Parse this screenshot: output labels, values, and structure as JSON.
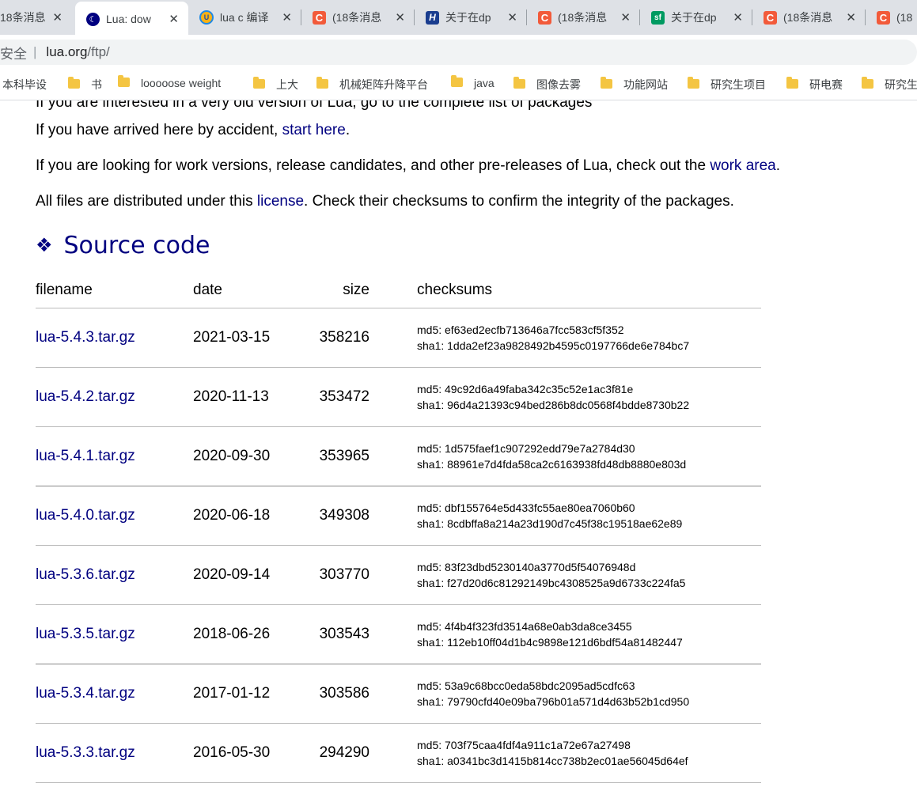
{
  "tabs": [
    {
      "title": "18条消息",
      "icon": "csdn-icon",
      "active": false
    },
    {
      "title": "Lua: dow",
      "icon": "lua-icon",
      "active": true
    },
    {
      "title": "lua c 编译",
      "icon": "uc-icon",
      "active": false
    },
    {
      "title": "(18条消息",
      "icon": "csdn-icon",
      "active": false
    },
    {
      "title": "关于在dp",
      "icon": "h-icon",
      "active": false
    },
    {
      "title": "(18条消息",
      "icon": "csdn-icon",
      "active": false
    },
    {
      "title": "关于在dp",
      "icon": "segmentfault-icon",
      "active": false
    },
    {
      "title": "(18条消息",
      "icon": "csdn-icon",
      "active": false
    },
    {
      "title": "(18",
      "icon": "csdn-icon",
      "active": false
    }
  ],
  "address": {
    "security": "安全",
    "host": "lua.org",
    "path": "/ftp/"
  },
  "bookmarks": [
    {
      "label": "本科毕设"
    },
    {
      "label": "书"
    },
    {
      "label": "looooose weight"
    },
    {
      "label": "上大"
    },
    {
      "label": "机械矩阵升降平台"
    },
    {
      "label": "java"
    },
    {
      "label": "图像去雾"
    },
    {
      "label": "功能网站"
    },
    {
      "label": "研究生项目"
    },
    {
      "label": "研电赛"
    },
    {
      "label": "研究生"
    }
  ],
  "content": {
    "cut_line": "If you are interested in a very old version of Lua, go to the complete list of packages",
    "p1_pre": "If you have arrived here by accident, ",
    "p1_link": "start here",
    "p1_post": ".",
    "p2_pre": "If you are looking for work versions, release candidates, and other pre-releases of Lua, check out the ",
    "p2_link": "work area",
    "p2_post": ".",
    "p3_pre": "All files are distributed under this ",
    "p3_link": "license",
    "p3_post": ". Check their checksums to confirm the integrity of the packages.",
    "section_symbol": "❖",
    "section_title": "Source code"
  },
  "table": {
    "headers": {
      "filename": "filename",
      "date": "date",
      "size": "size",
      "checksums": "checksums"
    },
    "rows": [
      {
        "name": "lua-5.4.3.tar.gz",
        "date": "2021-03-15",
        "size": "358216",
        "md5": "md5: ef63ed2ecfb713646a7fcc583cf5f352",
        "sha1": "sha1: 1dda2ef23a9828492b4595c0197766de6e784bc7"
      },
      {
        "name": "lua-5.4.2.tar.gz",
        "date": "2020-11-13",
        "size": "353472",
        "md5": "md5: 49c92d6a49faba342c35c52e1ac3f81e",
        "sha1": "sha1: 96d4a21393c94bed286b8dc0568f4bdde8730b22"
      },
      {
        "name": "lua-5.4.1.tar.gz",
        "date": "2020-09-30",
        "size": "353965",
        "md5": "md5: 1d575faef1c907292edd79e7a2784d30",
        "sha1": "sha1: 88961e7d4fda58ca2c6163938fd48db8880e803d"
      },
      {
        "name": "lua-5.4.0.tar.gz",
        "date": "2020-06-18",
        "size": "349308",
        "md5": "md5: dbf155764e5d433fc55ae80ea7060b60",
        "sha1": "sha1: 8cdbffa8a214a23d190d7c45f38c19518ae62e89"
      },
      {
        "name": "lua-5.3.6.tar.gz",
        "date": "2020-09-14",
        "size": "303770",
        "md5": "md5: 83f23dbd5230140a3770d5f54076948d",
        "sha1": "sha1: f27d20d6c81292149bc4308525a9d6733c224fa5"
      },
      {
        "name": "lua-5.3.5.tar.gz",
        "date": "2018-06-26",
        "size": "303543",
        "md5": "md5: 4f4b4f323fd3514a68e0ab3da8ce3455",
        "sha1": "sha1: 112eb10ff04d1b4c9898e121d6bdf54a81482447"
      },
      {
        "name": "lua-5.3.4.tar.gz",
        "date": "2017-01-12",
        "size": "303586",
        "md5": "md5: 53a9c68bcc0eda58bdc2095ad5cdfc63",
        "sha1": "sha1: 79790cfd40e09ba796b01a571d4d63b52b1cd950"
      },
      {
        "name": "lua-5.3.3.tar.gz",
        "date": "2016-05-30",
        "size": "294290",
        "md5": "md5: 703f75caa4fdf4a911c1a72e67a27498",
        "sha1": "sha1: a0341bc3d1415b814cc738b2ec01ae56045d64ef"
      }
    ]
  },
  "colors": {
    "link": "#000080",
    "tabstrip": "#dee1e6",
    "omnibox": "#f1f3f4"
  }
}
